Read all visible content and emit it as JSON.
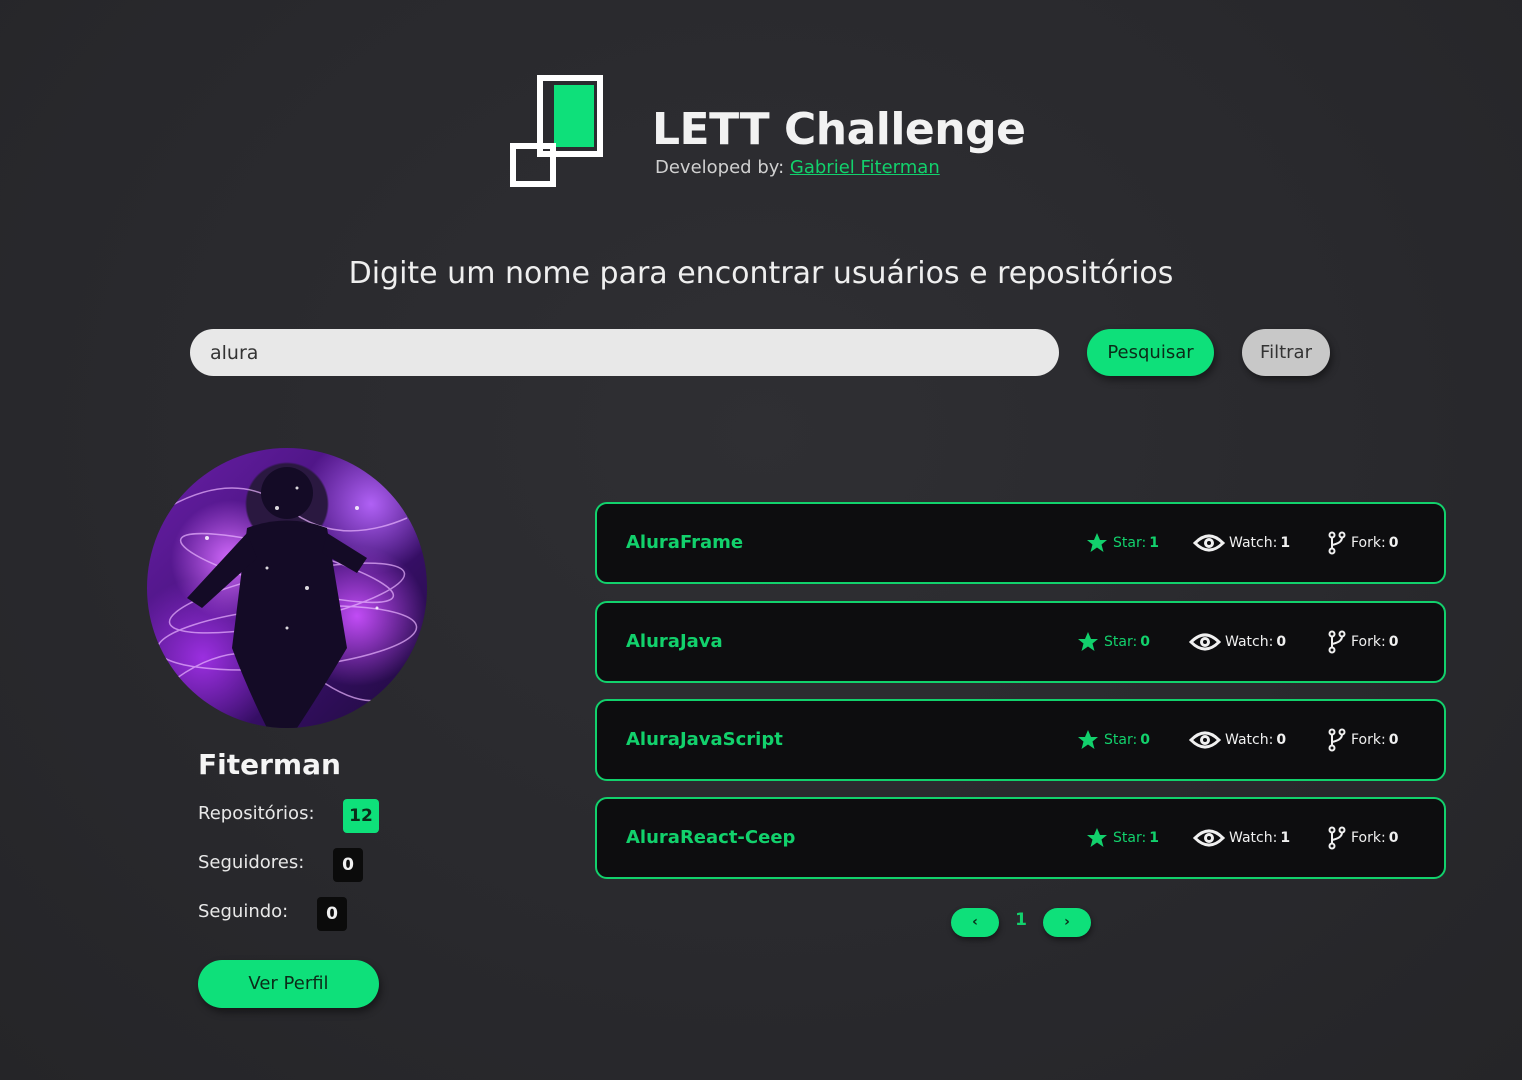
{
  "header": {
    "title": "LETT Challenge",
    "developed_by_label": "Developed by:",
    "developer_name": "Gabriel Fiterman"
  },
  "headline": "Digite um nome para encontrar usuários e repositórios",
  "search": {
    "value": "alura",
    "search_button": "Pesquisar",
    "filter_button": "Filtrar"
  },
  "profile": {
    "name": "Fiterman",
    "stats": [
      {
        "label": "Repositórios:",
        "value": "12"
      },
      {
        "label": "Seguidores:",
        "value": "0"
      },
      {
        "label": "Seguindo:",
        "value": "0"
      }
    ],
    "view_profile_button": "Ver Perfil"
  },
  "repos": [
    {
      "name": "AluraFrame",
      "star_label": "Star:",
      "stars": "1",
      "watch_label": "Watch:",
      "watch": "1",
      "fork_label": "Fork:",
      "forks": "0"
    },
    {
      "name": "AluraJava",
      "star_label": "Star:",
      "stars": "0",
      "watch_label": "Watch:",
      "watch": "0",
      "fork_label": "Fork:",
      "forks": "0"
    },
    {
      "name": "AluraJavaScript",
      "star_label": "Star:",
      "stars": "0",
      "watch_label": "Watch:",
      "watch": "0",
      "fork_label": "Fork:",
      "forks": "0"
    },
    {
      "name": "AluraReact-Ceep",
      "star_label": "Star:",
      "stars": "1",
      "watch_label": "Watch:",
      "watch": "1",
      "fork_label": "Fork:",
      "forks": "0"
    }
  ],
  "pagination": {
    "prev": "‹",
    "current": "1",
    "next": "›"
  },
  "colors": {
    "accent": "#0ee07a",
    "background": "#2b2b2f",
    "card": "#0d0d0f"
  },
  "icons": [
    "logo-mark",
    "star-icon",
    "eye-icon",
    "fork-icon"
  ]
}
